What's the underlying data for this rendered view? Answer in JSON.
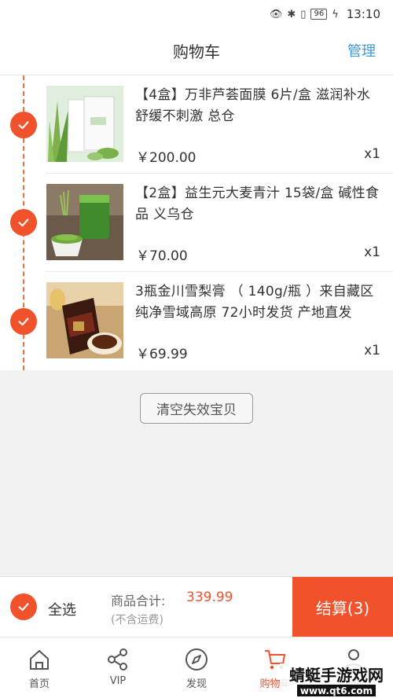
{
  "status_bar": {
    "battery": "96",
    "time": "13:10"
  },
  "header": {
    "title": "购物车",
    "manage_label": "管理"
  },
  "cart_items": [
    {
      "name": "【4盒】万非芦荟面膜 6片/盒 滋润补水 舒缓不刺激 总仓",
      "price": "￥200.00",
      "qty": "x1",
      "image_icon": "aloe-mask-product"
    },
    {
      "name": "【2盒】益生元大麦青汁  15袋/盒 碱性食品  义乌仓",
      "price": "￥70.00",
      "qty": "x1",
      "image_icon": "barley-juice-product"
    },
    {
      "name": "3瓶金川雪梨膏 （ 140g/瓶 ）来自藏区纯净雪域高原   72小时发货 产地直发",
      "price": "￥69.99",
      "qty": "x1",
      "image_icon": "pear-paste-product"
    }
  ],
  "clear_invalid_label": "清空失效宝贝",
  "checkout": {
    "select_all_label": "全选",
    "total_label": "商品合计:",
    "total_value": "339.99",
    "shipping_note": "(不含运费)",
    "checkout_label": "结算(3)"
  },
  "tabs": [
    {
      "label": "首页",
      "icon": "home-icon"
    },
    {
      "label": "VIP",
      "icon": "share-icon"
    },
    {
      "label": "发现",
      "icon": "compass-icon"
    },
    {
      "label": "购物车",
      "icon": "cart-icon",
      "active": true
    },
    {
      "label": "我的",
      "icon": "user-icon"
    }
  ],
  "colors": {
    "accent": "#f0522c",
    "link": "#3a9bdc"
  },
  "watermark": {
    "text": "蜻蜓手游戏网",
    "url": "www.qt6.com"
  }
}
